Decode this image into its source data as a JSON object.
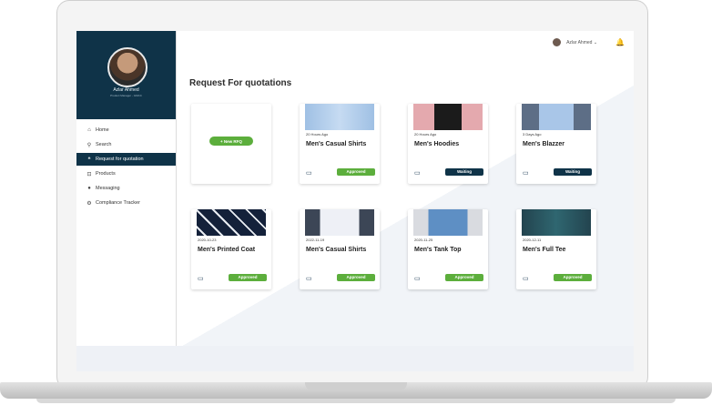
{
  "profile": {
    "name": "Azlar Ahmed",
    "role": "Product Manager - GMCC"
  },
  "nav": [
    {
      "icon": "home-icon",
      "label": "Home",
      "glyph": "⌂"
    },
    {
      "icon": "search-icon",
      "label": "Search",
      "glyph": "⚲"
    },
    {
      "icon": "quote-icon",
      "label": "Request for quotation",
      "glyph": "❝"
    },
    {
      "icon": "cart-icon",
      "label": "Products",
      "glyph": "⊡"
    },
    {
      "icon": "message-icon",
      "label": "Messaging",
      "glyph": "●"
    },
    {
      "icon": "gear-icon",
      "label": "Compliance Tracker",
      "glyph": "⚙"
    }
  ],
  "header": {
    "user": "Azlar Ahmed",
    "chevron": "⌄",
    "bell": "🔔"
  },
  "page": {
    "title": "Request For quotations"
  },
  "new_rfq": {
    "label": "+ New RFQ"
  },
  "colors": {
    "primary": "#0f3348",
    "approved": "#5cae3c"
  },
  "cards": [
    {
      "date": "20 Hours Ago",
      "name": "Men's Casual Shirts",
      "status": "Approved",
      "image": "light-blue shirt"
    },
    {
      "date": "20 Hours Ago",
      "name": "Men's Hoodies",
      "status": "Waiting",
      "image": "black hoodie"
    },
    {
      "date": "3 Days Ago",
      "name": "Men's Blazzer",
      "status": "Waiting",
      "image": "light blue blazer"
    },
    {
      "date": "2020-10-23",
      "name": "Men's Printed Coat",
      "status": "Approved",
      "image": "printed coat"
    },
    {
      "date": "2022-11-19",
      "name": "Men's Casual Shirts",
      "status": "Approved",
      "image": "white shirt"
    },
    {
      "date": "2020-11-25",
      "name": "Men's Tank Top",
      "status": "Approved",
      "image": "blue tank top"
    },
    {
      "date": "2020-12-11",
      "name": "Men's Full Tee",
      "status": "Approved",
      "image": "teal tee"
    }
  ]
}
